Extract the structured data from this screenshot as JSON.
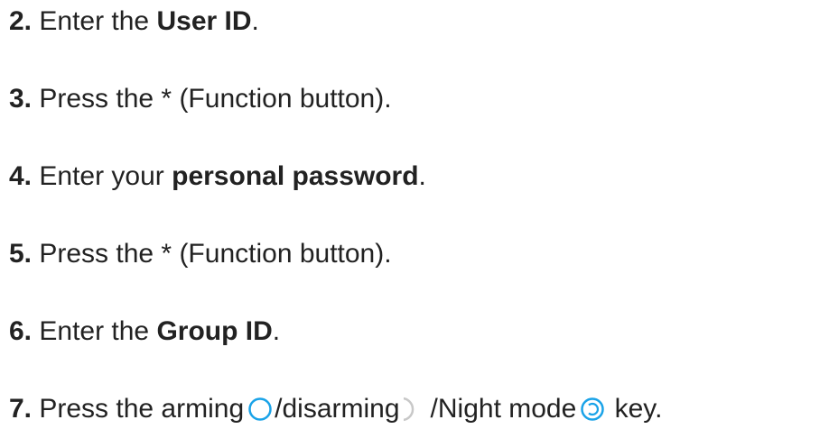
{
  "steps": [
    {
      "number": "2.",
      "text_before": "Enter the",
      "bold": "User ID",
      "text_after": "."
    },
    {
      "number": "3.",
      "text": "Press the * (Function button)."
    },
    {
      "number": "4.",
      "text_before": "Enter your",
      "bold": "personal password",
      "text_after": "."
    },
    {
      "number": "5.",
      "text": "Press the * (Function button)."
    },
    {
      "number": "6.",
      "text_before": "Enter the",
      "bold": "Group ID",
      "text_after": "."
    },
    {
      "number": "7.",
      "text_before": "Press the arming",
      "text_mid1": "/disarming",
      "text_mid2": "/Night mode",
      "text_after": "key.",
      "icons": {
        "arming": "arming-circle-icon",
        "disarming": "disarming-crescent-icon",
        "night": "night-mode-icon"
      },
      "icon_colors": {
        "arming": "#1aa3e8",
        "disarming": "#c8c8c8",
        "night": "#1aa3e8"
      }
    }
  ]
}
